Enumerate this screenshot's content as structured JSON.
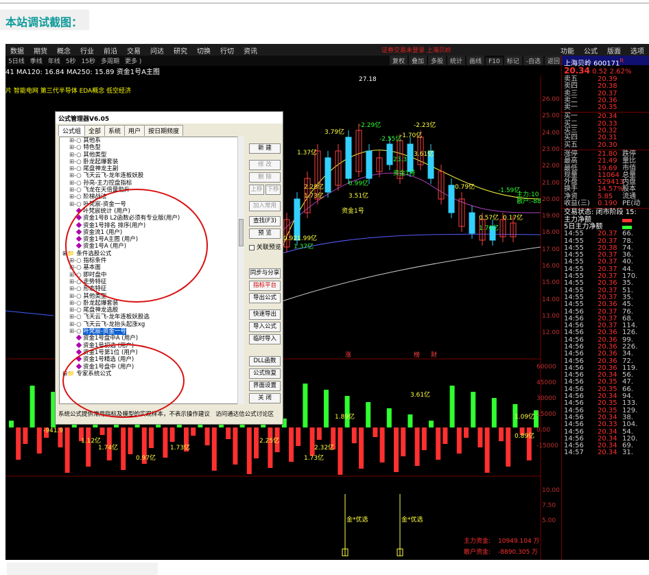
{
  "caption": "本站调试截图：",
  "menu": {
    "left": [
      "数据",
      "期货",
      "概念",
      "行业",
      "前沿",
      "交易",
      "问达",
      "研究",
      "切换",
      "行切",
      "资讯"
    ],
    "center": "证券交易未登录  上海贝岭",
    "right": [
      "功能",
      "公式",
      "版面",
      "选项"
    ]
  },
  "toolbar": {
    "left": [
      "5日线",
      "季线",
      "年线",
      "5秒",
      "15秒",
      "多周期",
      "更多 )"
    ],
    "right": [
      "复权",
      "叠加",
      "多股",
      "统计",
      "画线",
      "F10",
      "标记",
      "-自选",
      "返回"
    ]
  },
  "ma_row": "41  MA120: 16.84  MA250: 15.89  资金1号A主图",
  "tags_row": "片 智能电网 第三代半导体 EDA概念 低空经济",
  "price_axis": [
    "26.00",
    "25.00",
    "24.00",
    "23.00",
    "22.00",
    "21.00",
    "20.00",
    "19.00",
    "18.00",
    "17.00",
    "16.00",
    "15.00",
    "14.00",
    "13.00",
    "12.00"
  ],
  "vol_axis": [
    "60000",
    "45000",
    "30000",
    "15000",
    "0.00",
    "-15000"
  ],
  "ind_axis": [
    "10.00",
    "7.50",
    "5.00"
  ],
  "chart_labels": {
    "high": "27.18",
    "items": [
      "-2.29亿",
      "-2.23亿",
      "3.79亿",
      "-2.55亿",
      "-1.70亿",
      "1.37亿",
      "23.3",
      "3.61亿",
      "2.28亿",
      "0.99亿",
      "1.73亿",
      "3.51亿",
      "资金1号",
      "资金1号",
      "0.79亿",
      "-1.59亿",
      "0.57亿",
      "0.17亿",
      "1.76亿",
      "0.92",
      "1.99亿",
      "1.37亿"
    ],
    "vol_items": [
      "-941.9",
      "3.61亿",
      "1.09亿",
      "1.89亿",
      "1.73亿",
      "0.97亿",
      "2.25亿",
      "1.73亿",
      "1.12亿",
      "1.74亿",
      "2.32亿",
      "0.89亿"
    ],
    "flags": [
      "涨",
      "榜",
      "财"
    ],
    "sig": [
      "金*优选",
      "金*优选"
    ],
    "main_flow_label": "主力:10",
    "retail_label": "散户:-88",
    "bottom1": "主力资金:",
    "bottom1_val": "10949.104 万",
    "bottom2": "散户资金:",
    "bottom2_val": "-8890.305 万"
  },
  "right_panel": {
    "stock": "上海贝岭 600171",
    "price": "20.34",
    "change": "0.52",
    "pct": "2.62%",
    "asks": [
      [
        "卖五",
        "20.39"
      ],
      [
        "卖四",
        "20.38"
      ],
      [
        "卖三",
        "20.37"
      ],
      [
        "卖二",
        "20.36"
      ],
      [
        "卖一",
        "20.35"
      ]
    ],
    "bids": [
      [
        "买一",
        "20.34"
      ],
      [
        "买二",
        "20.33"
      ],
      [
        "买三",
        "20.32"
      ],
      [
        "买四",
        "20.31"
      ],
      [
        "买五",
        "20.30"
      ]
    ],
    "stats": [
      [
        "涨停",
        "21.80",
        "跌停"
      ],
      [
        "最高",
        "21.49",
        "量比"
      ],
      [
        "最低",
        "19.69",
        "市值"
      ],
      [
        "现量",
        "11064",
        "总量"
      ],
      [
        "外盘",
        "529413",
        "内盘"
      ],
      [
        "换手",
        "14.57%",
        "股本"
      ],
      [
        "净资",
        "5.85",
        "流通"
      ],
      [
        "收益(三)",
        "0.190",
        "PE(动"
      ]
    ],
    "status": "交易状态: 闭市阶段 15:",
    "flow1": "主力净额",
    "flow2": "5日主力净额",
    "ticks": [
      [
        "14:55",
        "20.37",
        "66."
      ],
      [
        "14:55",
        "20.37",
        "78."
      ],
      [
        "14:55",
        "20.38",
        "74."
      ],
      [
        "14:55",
        "20.37",
        "36."
      ],
      [
        "14:55",
        "20.37",
        "40."
      ],
      [
        "14:55",
        "20.37",
        "44."
      ],
      [
        "14:55",
        "20.37",
        "170."
      ],
      [
        "14:55",
        "20.36",
        "35."
      ],
      [
        "14:55",
        "20.37",
        "51."
      ],
      [
        "14:55",
        "20.37",
        "35."
      ],
      [
        "14:55",
        "20.36",
        "45."
      ],
      [
        "14:56",
        "20.37",
        "76."
      ],
      [
        "14:56",
        "20.37",
        "68."
      ],
      [
        "14:56",
        "20.37",
        "114."
      ],
      [
        "14:56",
        "20.36",
        "126."
      ],
      [
        "14:56",
        "20.36",
        "99."
      ],
      [
        "14:56",
        "20.36",
        "226."
      ],
      [
        "14:56",
        "20.36",
        "34."
      ],
      [
        "14:56",
        "20.36",
        "72."
      ],
      [
        "14:56",
        "20.36",
        "119."
      ],
      [
        "14:56",
        "20.34",
        "56."
      ],
      [
        "14:56",
        "20.35",
        "47."
      ],
      [
        "14:56",
        "20.35",
        "66."
      ],
      [
        "14:56",
        "20.34",
        "94."
      ],
      [
        "14:56",
        "20.35",
        "133."
      ],
      [
        "14:56",
        "20.35",
        "129."
      ],
      [
        "14:56",
        "20.34",
        "38."
      ],
      [
        "14:56",
        "20.33",
        "104."
      ],
      [
        "14:56",
        "20.34",
        "54."
      ],
      [
        "14:56",
        "20.34",
        "120."
      ],
      [
        "14:56",
        "20.34",
        "69."
      ],
      [
        "14:57",
        "20.34",
        "31."
      ]
    ]
  },
  "dialog": {
    "title": "公式管理器V6.05",
    "tabs": [
      "公式组",
      "全部",
      "系统",
      "用户",
      "按日期频度"
    ],
    "tree": [
      {
        "t": "其他系",
        "lvl": 1,
        "kind": "fx"
      },
      {
        "t": "特色型",
        "lvl": 1,
        "kind": "fx"
      },
      {
        "t": "其他类型",
        "lvl": 1,
        "kind": "fx"
      },
      {
        "t": "卧龙起爆套装",
        "lvl": 1,
        "kind": "fx"
      },
      {
        "t": "尾盘神龙主副",
        "lvl": 1,
        "kind": "fx"
      },
      {
        "t": "飞天云飞-龙年连板妖股",
        "lvl": 1,
        "kind": "fx"
      },
      {
        "t": "孙亮-主力控盘指标",
        "lvl": 1,
        "kind": "fx"
      },
      {
        "t": "飞龙在天倍量助升",
        "lvl": 1,
        "kind": "fx"
      },
      {
        "t": "阶梯战法",
        "lvl": 1,
        "kind": "fx"
      },
      {
        "t": "叶梵宸-资金一号",
        "lvl": 1,
        "kind": "fx"
      },
      {
        "t": "叶梵宸统计 (用户)",
        "lvl": 2,
        "kind": "d"
      },
      {
        "t": "资金1号B  L2函数必须有专业版(用户)",
        "lvl": 2,
        "kind": "d"
      },
      {
        "t": "资金1号排名  排序(用户)",
        "lvl": 2,
        "kind": "d"
      },
      {
        "t": "资金流1 (用户)",
        "lvl": 2,
        "kind": "d"
      },
      {
        "t": "资金1号A主图 (用户)",
        "lvl": 2,
        "kind": "d"
      },
      {
        "t": "资金1号A  (用户)",
        "lvl": 2,
        "kind": "d"
      },
      {
        "t": "条件选股公式",
        "lvl": 0,
        "kind": "folder"
      },
      {
        "t": "指标条件",
        "lvl": 1,
        "kind": "fx"
      },
      {
        "t": "基本面",
        "lvl": 1,
        "kind": "fx"
      },
      {
        "t": "即时盘中",
        "lvl": 1,
        "kind": "fx"
      },
      {
        "t": "走势特征",
        "lvl": 1,
        "kind": "fx"
      },
      {
        "t": "形态特征",
        "lvl": 1,
        "kind": "fx"
      },
      {
        "t": "其他类型",
        "lvl": 1,
        "kind": "fx"
      },
      {
        "t": "卧龙起爆套装",
        "lvl": 1,
        "kind": "fx"
      },
      {
        "t": "尾盘神龙选股",
        "lvl": 1,
        "kind": "fx"
      },
      {
        "t": "飞天云飞-龙年连板妖股选",
        "lvl": 1,
        "kind": "fx"
      },
      {
        "t": "飞天云飞-龙抬头起涨xg",
        "lvl": 1,
        "kind": "fx"
      },
      {
        "t": "叶梵宸-资金一号",
        "lvl": 1,
        "kind": "sel"
      },
      {
        "t": "资金1号盘中A  (用户)",
        "lvl": 2,
        "kind": "d"
      },
      {
        "t": "资金1号初选  (用户)",
        "lvl": 2,
        "kind": "d"
      },
      {
        "t": "资金1号第1位  (用户)",
        "lvl": 2,
        "kind": "d"
      },
      {
        "t": "资金1号精选  (用户)",
        "lvl": 2,
        "kind": "d"
      },
      {
        "t": "资金1号盘中  (用户)",
        "lvl": 2,
        "kind": "d"
      },
      {
        "t": "专家系统公式",
        "lvl": 0,
        "kind": "folder"
      }
    ],
    "buttons": [
      "新 建",
      "修 改",
      "删 除",
      "上移",
      "下移",
      "加入常用",
      "查找(F3)",
      "预 览",
      "同步与分享",
      "指标平台",
      "导出公式",
      "快速导出",
      "导入公式",
      "临时导入",
      "DLL函数",
      "公式恢复",
      "界面设置",
      "关 闭"
    ],
    "checkbox": "关联预览",
    "status": "系统公式提供常用指标及模型的实现样本，不表示操作建议",
    "link": "访问通达信公式讨论区"
  }
}
